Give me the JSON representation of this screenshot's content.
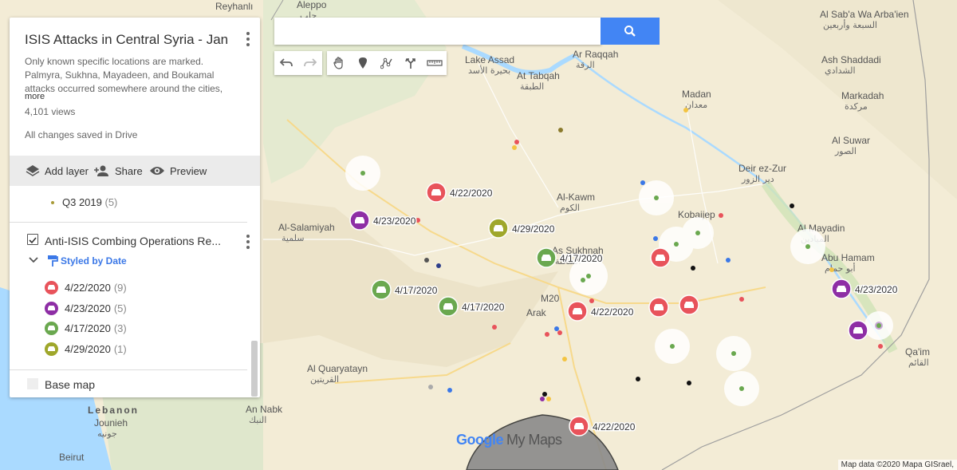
{
  "map": {
    "background": "#f3ecd6",
    "cities": [
      {
        "en": "Aleppo",
        "ar": "حلب"
      },
      {
        "en": "Reyhanlı",
        "ar": ""
      },
      {
        "en": "Ar Raqqah",
        "ar": "الرقة"
      },
      {
        "en": "At Tabqah",
        "ar": "الطبقة"
      },
      {
        "en": "Lake Assad",
        "ar": "بحيرة الأسد"
      },
      {
        "en": "Madan",
        "ar": "معدان"
      },
      {
        "en": "Al Sab'a Wa Arba'ien",
        "ar": "السبعة وأربعين"
      },
      {
        "en": "Ash Shaddadi",
        "ar": "الشدادي"
      },
      {
        "en": "Markadah",
        "ar": "مركدة"
      },
      {
        "en": "Al Suwar",
        "ar": "الصور"
      },
      {
        "en": "Deir ez-Zur",
        "ar": "دير الزور"
      },
      {
        "en": "Al Mayadin",
        "ar": "الميادين"
      },
      {
        "en": "Abu Hamam",
        "ar": "أبو حمام"
      },
      {
        "en": "Qa'im",
        "ar": "القائم"
      },
      {
        "en": "Al-Kawm",
        "ar": "الكوم"
      },
      {
        "en": "Kobaijep",
        "ar": ""
      },
      {
        "en": "As Sukhnah",
        "ar": "السخنة"
      },
      {
        "en": "Al-Salamiyah",
        "ar": "سلمية"
      },
      {
        "en": "Arak",
        "ar": ""
      },
      {
        "en": "Al Quaryatayn",
        "ar": "القريتين"
      },
      {
        "en": "An Nabk",
        "ar": "النبك"
      },
      {
        "en": "Lebanon",
        "ar": ""
      },
      {
        "en": "Jounieh",
        "ar": "جونيه"
      },
      {
        "en": "Beirut",
        "ar": ""
      },
      {
        "en": "M20",
        "ar": ""
      }
    ],
    "markers": [
      {
        "date": "4/22/2020",
        "color": "#e8535b"
      },
      {
        "date": "4/23/2020",
        "color": "#8e2ea5"
      },
      {
        "date": "4/29/2020",
        "color": "#9fa72b"
      },
      {
        "date": "4/17/2020",
        "color": "#6aa84f"
      },
      {
        "date": "4/17/2020",
        "color": "#6aa84f"
      },
      {
        "date": "4/17/2020",
        "color": "#6aa84f"
      },
      {
        "date": "4/22/2020",
        "color": "#e8535b"
      },
      {
        "date": "",
        "color": "#e8535b"
      },
      {
        "date": "",
        "color": "#e8535b"
      },
      {
        "date": "",
        "color": "#e8535b"
      },
      {
        "date": "4/23/2020",
        "color": "#8e2ea5"
      },
      {
        "date": "",
        "color": "#8e2ea5"
      },
      {
        "date": "4/22/2020",
        "color": "#e8535b"
      }
    ],
    "attribution": "Map data ©2020 Mapa GISrael,",
    "logo_google": "Google",
    "logo_mymaps": "My Maps"
  },
  "search": {
    "placeholder": "",
    "value": ""
  },
  "panel": {
    "title": "ISIS Attacks in Central Syria - Jan...",
    "description": "Only known specific locations are marked. Palmyra, Sukhna, Mayadeen, and Boukamal attacks occurred somewhere around the cities,",
    "more": "more",
    "views": "4,101 views",
    "saved": "All changes saved in Drive",
    "toolbar": {
      "add_layer": "Add layer",
      "share": "Share",
      "preview": "Preview"
    },
    "q3": {
      "label": "Q3 2019",
      "count": "(5)"
    },
    "layer": {
      "title": "Anti-ISIS Combing Operations Re...",
      "styled_by": "Styled by Date",
      "legend": [
        {
          "label": "4/22/2020",
          "count": "(9)",
          "color": "#e8535b"
        },
        {
          "label": "4/23/2020",
          "count": "(5)",
          "color": "#8e2ea5"
        },
        {
          "label": "4/17/2020",
          "count": "(3)",
          "color": "#6aa84f"
        },
        {
          "label": "4/29/2020",
          "count": "(1)",
          "color": "#9fa72b"
        }
      ]
    },
    "base_map": "Base map"
  }
}
